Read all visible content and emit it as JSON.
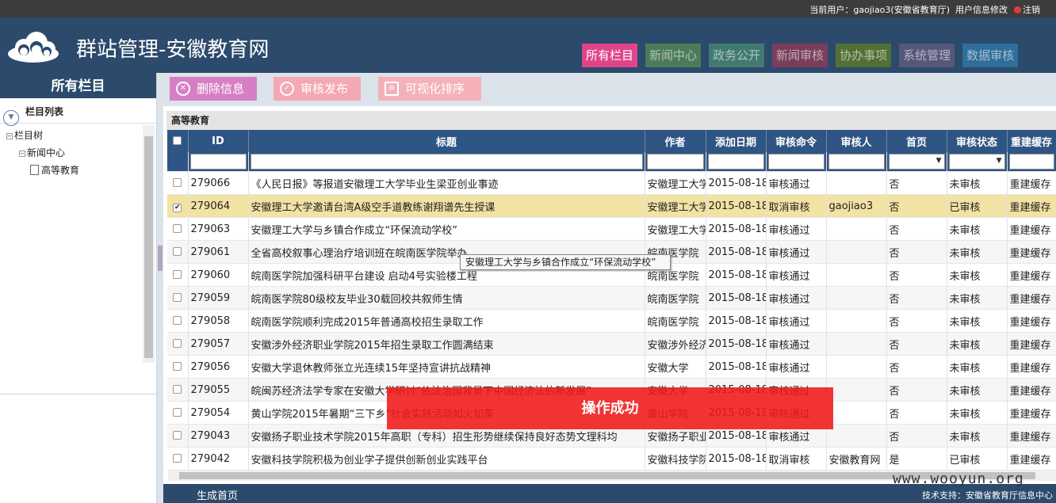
{
  "topbar": {
    "user_label": "当前用户：",
    "user_value": "gaojiao3(安徽省教育厅)",
    "profile_link": "用户信息修改",
    "logout_link": "注销"
  },
  "header": {
    "title": "群站管理-安徽教育网"
  },
  "nav": {
    "tabs": [
      {
        "label": "所有栏目",
        "color": "#e0448a"
      },
      {
        "label": "新闻中心",
        "color": "#4c7b5a"
      },
      {
        "label": "政务公开",
        "color": "#417a71"
      },
      {
        "label": "新闻审核",
        "color": "#7a3e5c"
      },
      {
        "label": "协办事项",
        "color": "#527036"
      },
      {
        "label": "系统管理",
        "color": "#56577a"
      },
      {
        "label": "数据审核",
        "color": "#2f6e9b"
      }
    ]
  },
  "sidebar": {
    "header": "所有栏目",
    "list_title": "栏目列表",
    "tree": {
      "root": "栏目树",
      "child": "新闻中心",
      "leaf": "高等教育"
    }
  },
  "toolbar": {
    "delete_label": "删除信息",
    "publish_label": "审核发布",
    "sort_label": "可视化排序",
    "delete_color": "#d77fc4",
    "publish_color": "#f4a8b3",
    "sort_color": "#f4b1b8"
  },
  "grid": {
    "caption": "高等教育",
    "columns": [
      "ID",
      "标题",
      "作者",
      "添加日期",
      "审核命令",
      "审核人",
      "首页",
      "审核状态",
      "重建缓存"
    ],
    "rows": [
      {
        "id": "279066",
        "title": "《人民日报》等报道安徽理工大学毕业生梁亚创业事迹",
        "author": "安徽理工大学",
        "date": "2015-08-18",
        "cmd": "审核通过",
        "reviewer": "",
        "home": "否",
        "status": "未审核",
        "cache": "重建缓存"
      },
      {
        "id": "279064",
        "title": "安徽理工大学邀请台湾A级空手道教练谢翔谱先生授课",
        "author": "安徽理工大学",
        "date": "2015-08-18",
        "cmd": "取消审核",
        "reviewer": "gaojiao3",
        "home": "否",
        "status": "已审核",
        "cache": "重建缓存"
      },
      {
        "id": "279063",
        "title": "安徽理工大学与乡镇合作成立“环保流动学校”",
        "author": "安徽理工大学",
        "date": "2015-08-18",
        "cmd": "审核通过",
        "reviewer": "",
        "home": "否",
        "status": "未审核",
        "cache": "重建缓存"
      },
      {
        "id": "279061",
        "title": "全省高校叙事心理治疗培训班在皖南医学院举办",
        "author": "皖南医学院",
        "date": "2015-08-18",
        "cmd": "审核通过",
        "reviewer": "",
        "home": "否",
        "status": "未审核",
        "cache": "重建缓存"
      },
      {
        "id": "279060",
        "title": "皖南医学院加强科研平台建设 启动4号实验楼工程",
        "author": "皖南医学院",
        "date": "2015-08-18",
        "cmd": "审核通过",
        "reviewer": "",
        "home": "否",
        "status": "未审核",
        "cache": "重建缓存"
      },
      {
        "id": "279059",
        "title": "皖南医学院80级校友毕业30载回校共叙师生情",
        "author": "皖南医学院",
        "date": "2015-08-18",
        "cmd": "审核通过",
        "reviewer": "",
        "home": "否",
        "status": "未审核",
        "cache": "重建缓存"
      },
      {
        "id": "279058",
        "title": "皖南医学院顺利完成2015年普通高校招生录取工作",
        "author": "皖南医学院",
        "date": "2015-08-18",
        "cmd": "审核通过",
        "reviewer": "",
        "home": "否",
        "status": "未审核",
        "cache": "重建缓存"
      },
      {
        "id": "279057",
        "title": "安徽涉外经济职业学院2015年招生录取工作圆满结束",
        "author": "安徽涉外经济",
        "date": "2015-08-18",
        "cmd": "审核通过",
        "reviewer": "",
        "home": "否",
        "status": "未审核",
        "cache": "重建缓存"
      },
      {
        "id": "279056",
        "title": "安徽大学退休教师张立光连续15年坚持宣讲抗战精神",
        "author": "安徽大学",
        "date": "2015-08-18",
        "cmd": "审核通过",
        "reviewer": "",
        "home": "否",
        "status": "未审核",
        "cache": "重建缓存"
      },
      {
        "id": "279055",
        "title": "皖闽苏经济法学专家在安徽大学研讨“依法治国背景下中国经济法的新发展”",
        "author": "安徽大学",
        "date": "2015-08-18",
        "cmd": "审核通过",
        "reviewer": "",
        "home": "否",
        "status": "未审核",
        "cache": "重建缓存"
      },
      {
        "id": "279054",
        "title": "黄山学院2015年暑期“三下乡”社会实践活动如火如荼",
        "author": "黄山学院",
        "date": "2015-08-18",
        "cmd": "审核通过",
        "reviewer": "",
        "home": "否",
        "status": "未审核",
        "cache": "重建缓存"
      },
      {
        "id": "279043",
        "title": "安徽扬子职业技术学院2015年高职（专科）招生形势继续保持良好态势文理科均",
        "author": "安徽扬子职业",
        "date": "2015-08-18",
        "cmd": "审核通过",
        "reviewer": "",
        "home": "否",
        "status": "未审核",
        "cache": "重建缓存"
      },
      {
        "id": "279042",
        "title": "安徽科技学院积极为创业学子提供创新创业实践平台",
        "author": "安徽科技学院",
        "date": "2015-08-18",
        "cmd": "取消审核",
        "reviewer": "安徽教育网",
        "home": "是",
        "status": "已审核",
        "cache": "重建缓存"
      }
    ]
  },
  "tooltip": "安徽理工大学与乡镇合作成立“环保流动学校”",
  "toast": "操作成功",
  "statusbar": {
    "left": "生成首页",
    "right": "技术支持：安徽省教育厅信息中心"
  },
  "watermark": "www.wooyun.org"
}
